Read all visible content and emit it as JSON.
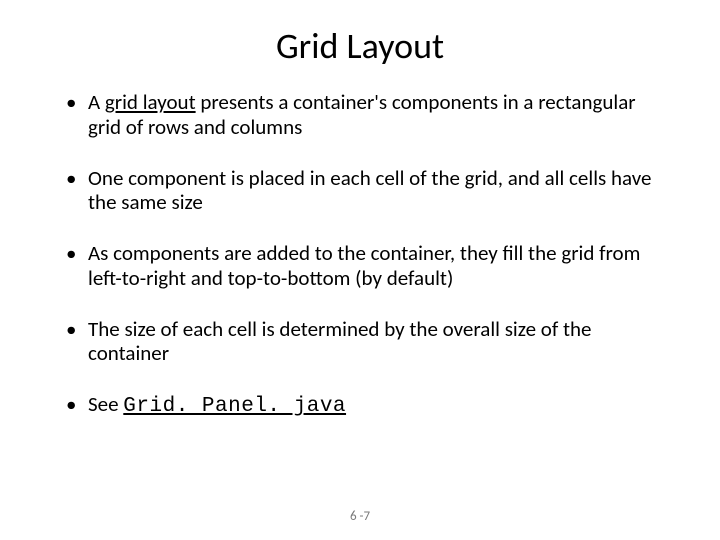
{
  "title": "Grid Layout",
  "bullets": {
    "b1_pre": "A ",
    "b1_term": "grid layout",
    "b1_post": " presents a container's components in a rectangular grid of rows and columns",
    "b2": "One component is placed in each cell of the grid, and all cells have the same size",
    "b3": "As components are added to the container, they fill the grid from left-to-right and top-to-bottom (by default)",
    "b4": "The size of each cell is determined by the overall size of the container",
    "b5_pre": "See ",
    "b5_link": "Grid. Panel. java"
  },
  "footer": "6 -7"
}
